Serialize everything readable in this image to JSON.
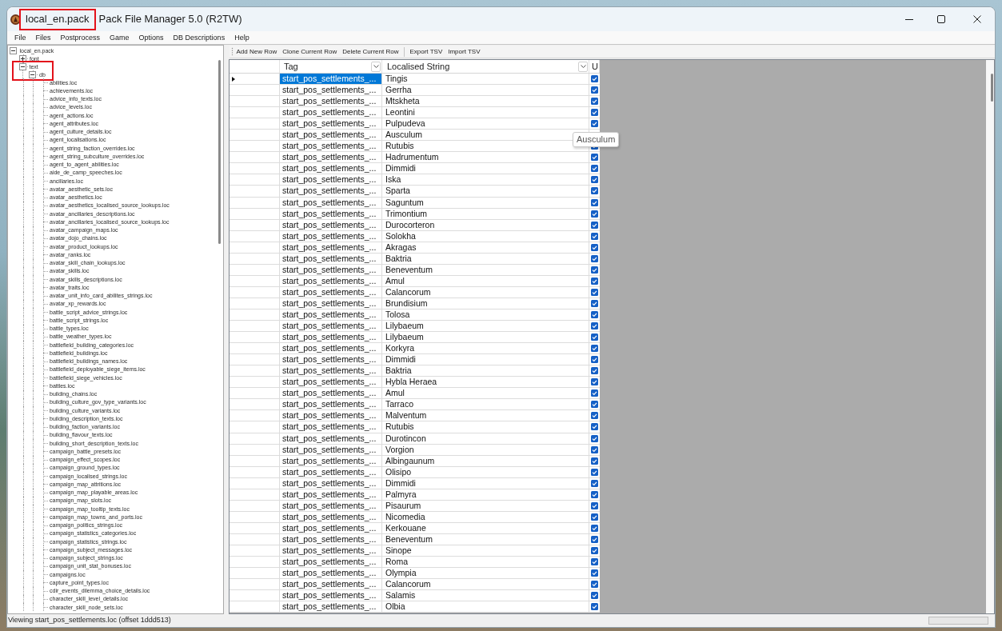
{
  "window": {
    "file_name": {
      "text": "local_en.pack",
      "highlighted": true
    },
    "title": "Pack File Manager 5.0 (R2TW)"
  },
  "menu": [
    "File",
    "Files",
    "Postprocess",
    "Game",
    "Options",
    "DB Descriptions",
    "Help"
  ],
  "tree": [
    {
      "label": "local_en.pack",
      "expanded": true,
      "selected": false,
      "children": [
        {
          "label": "font",
          "expanded": false,
          "selected": false
        },
        {
          "label": "text",
          "expanded": true,
          "selected": false,
          "highlighted": true,
          "children": [
            {
              "label": "db",
              "expanded": true,
              "selected": false,
              "highlighted": true,
              "children": [
                {
                  "label": "abilities.loc",
                  "selected": false
                },
                {
                  "label": "achievements.loc",
                  "selected": false
                },
                {
                  "label": "advice_info_texts.loc",
                  "selected": false
                },
                {
                  "label": "advice_levels.loc",
                  "selected": false
                },
                {
                  "label": "agent_actions.loc",
                  "selected": false
                },
                {
                  "label": "agent_attributes.loc",
                  "selected": false
                },
                {
                  "label": "agent_culture_details.loc",
                  "selected": false
                },
                {
                  "label": "agent_localisations.loc",
                  "selected": false
                },
                {
                  "label": "agent_string_faction_overrides.loc",
                  "selected": false
                },
                {
                  "label": "agent_string_subculture_overrides.loc",
                  "selected": false
                },
                {
                  "label": "agent_to_agent_abilities.loc",
                  "selected": false
                },
                {
                  "label": "aide_de_camp_speeches.loc",
                  "selected": false
                },
                {
                  "label": "ancillaries.loc",
                  "selected": false
                },
                {
                  "label": "avatar_aesthetic_sets.loc",
                  "selected": false
                },
                {
                  "label": "avatar_aesthetics.loc",
                  "selected": false
                },
                {
                  "label": "avatar_aesthetics_localised_source_lookups.loc",
                  "selected": false
                },
                {
                  "label": "avatar_ancillaries_descriptions.loc",
                  "selected": false
                },
                {
                  "label": "avatar_ancillaries_localised_source_lookups.loc",
                  "selected": false
                },
                {
                  "label": "avatar_campaign_maps.loc",
                  "selected": false
                },
                {
                  "label": "avatar_dojo_chains.loc",
                  "selected": false
                },
                {
                  "label": "avatar_product_lookups.loc",
                  "selected": false
                },
                {
                  "label": "avatar_ranks.loc",
                  "selected": false
                },
                {
                  "label": "avatar_skill_chain_lookups.loc",
                  "selected": false
                },
                {
                  "label": "avatar_skills.loc",
                  "selected": false
                },
                {
                  "label": "avatar_skills_descriptions.loc",
                  "selected": false
                },
                {
                  "label": "avatar_traits.loc",
                  "selected": false
                },
                {
                  "label": "avatar_unit_info_card_abilites_strings.loc",
                  "selected": false
                },
                {
                  "label": "avatar_xp_rewards.loc",
                  "selected": false
                },
                {
                  "label": "battle_script_advice_strings.loc",
                  "selected": false
                },
                {
                  "label": "battle_script_strings.loc",
                  "selected": false
                },
                {
                  "label": "battle_types.loc",
                  "selected": false
                },
                {
                  "label": "battle_weather_types.loc",
                  "selected": false
                },
                {
                  "label": "battlefield_building_categories.loc",
                  "selected": false
                },
                {
                  "label": "battlefield_buildings.loc",
                  "selected": false
                },
                {
                  "label": "battlefield_buildings_names.loc",
                  "selected": false
                },
                {
                  "label": "battlefield_deployable_siege_items.loc",
                  "selected": false
                },
                {
                  "label": "battlefield_siege_vehicles.loc",
                  "selected": false
                },
                {
                  "label": "battles.loc",
                  "selected": false
                },
                {
                  "label": "building_chains.loc",
                  "selected": false
                },
                {
                  "label": "building_culture_gov_type_variants.loc",
                  "selected": false
                },
                {
                  "label": "building_culture_variants.loc",
                  "selected": false
                },
                {
                  "label": "building_description_texts.loc",
                  "selected": false
                },
                {
                  "label": "building_faction_variants.loc",
                  "selected": false
                },
                {
                  "label": "building_flavour_texts.loc",
                  "selected": false
                },
                {
                  "label": "building_short_description_texts.loc",
                  "selected": false
                },
                {
                  "label": "campaign_battle_presets.loc",
                  "selected": false
                },
                {
                  "label": "campaign_effect_scopes.loc",
                  "selected": false
                },
                {
                  "label": "campaign_ground_types.loc",
                  "selected": false
                },
                {
                  "label": "campaign_localised_strings.loc",
                  "selected": false
                },
                {
                  "label": "campaign_map_attritions.loc",
                  "selected": false
                },
                {
                  "label": "campaign_map_playable_areas.loc",
                  "selected": false
                },
                {
                  "label": "campaign_map_slots.loc",
                  "selected": false
                },
                {
                  "label": "campaign_map_tooltip_texts.loc",
                  "selected": false
                },
                {
                  "label": "campaign_map_towns_and_ports.loc",
                  "selected": false
                },
                {
                  "label": "campaign_politics_strings.loc",
                  "selected": false
                },
                {
                  "label": "campaign_statistics_categories.loc",
                  "selected": false
                },
                {
                  "label": "campaign_statistics_strings.loc",
                  "selected": false
                },
                {
                  "label": "campaign_subject_messages.loc",
                  "selected": false
                },
                {
                  "label": "campaign_subject_strings.loc",
                  "selected": false
                },
                {
                  "label": "campaign_unit_stat_bonuses.loc",
                  "selected": false
                },
                {
                  "label": "campaigns.loc",
                  "selected": false
                },
                {
                  "label": "capture_point_types.loc",
                  "selected": false
                },
                {
                  "label": "cdir_events_dilemma_choice_details.loc",
                  "selected": false
                },
                {
                  "label": "character_skill_level_details.loc",
                  "selected": false
                },
                {
                  "label": "character_skill_node_sets.loc",
                  "selected": false
                }
              ]
            }
          ]
        }
      ]
    }
  ],
  "toolbar": {
    "groups": [
      [
        "Add New Row",
        "Clone Current Row",
        "Delete Current Row"
      ],
      [
        "Export TSV",
        "Import TSV"
      ]
    ]
  },
  "table": {
    "columns": [
      {
        "label": "Tag",
        "filter_button": true
      },
      {
        "label": "Localised String",
        "filter_button": true
      },
      {
        "label": "U",
        "filter_button": false
      }
    ],
    "rows": [
      {
        "tag": "start_pos_settlements_...",
        "string": "Tingis",
        "checked": true,
        "selected": true
      },
      {
        "tag": "start_pos_settlements_...",
        "string": "Gerrha",
        "checked": true,
        "selected": false
      },
      {
        "tag": "start_pos_settlements_...",
        "string": "Mtskheta",
        "checked": true,
        "selected": false
      },
      {
        "tag": "start_pos_settlements_...",
        "string": "Leontini",
        "checked": true,
        "selected": false
      },
      {
        "tag": "start_pos_settlements_...",
        "string": "Pulpudeva",
        "checked": true,
        "selected": false
      },
      {
        "tag": "start_pos_settlements_...",
        "string": "Ausculum",
        "selected": false
      },
      {
        "tag": "start_pos_settlements_...",
        "string": "Rutubis",
        "checked": true,
        "selected": false
      },
      {
        "tag": "start_pos_settlements_...",
        "string": "Hadrumentum",
        "checked": true,
        "selected": false
      },
      {
        "tag": "start_pos_settlements_...",
        "string": "Dimmidi",
        "checked": true,
        "selected": false
      },
      {
        "tag": "start_pos_settlements_...",
        "string": "Iska",
        "checked": true,
        "selected": false
      },
      {
        "tag": "start_pos_settlements_...",
        "string": "Sparta",
        "checked": true,
        "selected": false
      },
      {
        "tag": "start_pos_settlements_...",
        "string": "Saguntum",
        "checked": true,
        "selected": false
      },
      {
        "tag": "start_pos_settlements_...",
        "string": "Trimontium",
        "checked": true,
        "selected": false
      },
      {
        "tag": "start_pos_settlements_...",
        "string": "Durocorteron",
        "checked": true,
        "selected": false
      },
      {
        "tag": "start_pos_settlements_...",
        "string": "Solokha",
        "checked": true,
        "selected": false
      },
      {
        "tag": "start_pos_settlements_...",
        "string": "Akragas",
        "checked": true,
        "selected": false
      },
      {
        "tag": "start_pos_settlements_...",
        "string": "Baktria",
        "checked": true,
        "selected": false
      },
      {
        "tag": "start_pos_settlements_...",
        "string": "Beneventum",
        "checked": true,
        "selected": false
      },
      {
        "tag": "start_pos_settlements_...",
        "string": "Amul",
        "checked": true,
        "selected": false
      },
      {
        "tag": "start_pos_settlements_...",
        "string": "Calancorum",
        "checked": true,
        "selected": false
      },
      {
        "tag": "start_pos_settlements_...",
        "string": "Brundisium",
        "checked": true,
        "selected": false
      },
      {
        "tag": "start_pos_settlements_...",
        "string": "Tolosa",
        "checked": true,
        "selected": false
      },
      {
        "tag": "start_pos_settlements_...",
        "string": "Lilybaeum",
        "checked": true,
        "selected": false
      },
      {
        "tag": "start_pos_settlements_...",
        "string": "Lilybaeum",
        "checked": true,
        "selected": false
      },
      {
        "tag": "start_pos_settlements_...",
        "string": "Korkyra",
        "checked": true,
        "selected": false
      },
      {
        "tag": "start_pos_settlements_...",
        "string": "Dimmidi",
        "checked": true,
        "selected": false
      },
      {
        "tag": "start_pos_settlements_...",
        "string": "Baktria",
        "checked": true,
        "selected": false
      },
      {
        "tag": "start_pos_settlements_...",
        "string": "Hybla Heraea",
        "checked": true,
        "selected": false
      },
      {
        "tag": "start_pos_settlements_...",
        "string": "Amul",
        "checked": true,
        "selected": false
      },
      {
        "tag": "start_pos_settlements_...",
        "string": "Tarraco",
        "checked": true,
        "selected": false
      },
      {
        "tag": "start_pos_settlements_...",
        "string": "Malventum",
        "checked": true,
        "selected": false
      },
      {
        "tag": "start_pos_settlements_...",
        "string": "Rutubis",
        "checked": true,
        "selected": false
      },
      {
        "tag": "start_pos_settlements_...",
        "string": "Durotincon",
        "checked": true,
        "selected": false
      },
      {
        "tag": "start_pos_settlements_...",
        "string": "Vorgion",
        "checked": true,
        "selected": false
      },
      {
        "tag": "start_pos_settlements_...",
        "string": "Albingaunum",
        "checked": true,
        "selected": false
      },
      {
        "tag": "start_pos_settlements_...",
        "string": "Olisipo",
        "checked": true,
        "selected": false
      },
      {
        "tag": "start_pos_settlements_...",
        "string": "Dimmidi",
        "checked": true,
        "selected": false
      },
      {
        "tag": "start_pos_settlements_...",
        "string": "Palmyra",
        "checked": true,
        "selected": false
      },
      {
        "tag": "start_pos_settlements_...",
        "string": "Pisaurum",
        "checked": true,
        "selected": false
      },
      {
        "tag": "start_pos_settlements_...",
        "string": "Nicomedia",
        "checked": true,
        "selected": false
      },
      {
        "tag": "start_pos_settlements_...",
        "string": "Kerkouane",
        "checked": true,
        "selected": false
      },
      {
        "tag": "start_pos_settlements_...",
        "string": "Beneventum",
        "checked": true,
        "selected": false
      },
      {
        "tag": "start_pos_settlements_...",
        "string": "Sinope",
        "checked": true,
        "selected": false
      },
      {
        "tag": "start_pos_settlements_...",
        "string": "Roma",
        "checked": true,
        "selected": false
      },
      {
        "tag": "start_pos_settlements_...",
        "string": "Olympia",
        "checked": true,
        "selected": false
      },
      {
        "tag": "start_pos_settlements_...",
        "string": "Calancorum",
        "checked": true,
        "selected": false
      },
      {
        "tag": "start_pos_settlements_...",
        "string": "Salamis",
        "checked": true,
        "selected": false
      },
      {
        "tag": "start_pos_settlements_...",
        "string": "Olbia",
        "checked": true,
        "selected": false
      }
    ],
    "tooltip": {
      "text": "Ausculum"
    }
  },
  "status_bar": {
    "text": "Viewing start_pos_settlements.loc (offset 1ddd513)",
    "progress": {
      "level": 0
    }
  }
}
